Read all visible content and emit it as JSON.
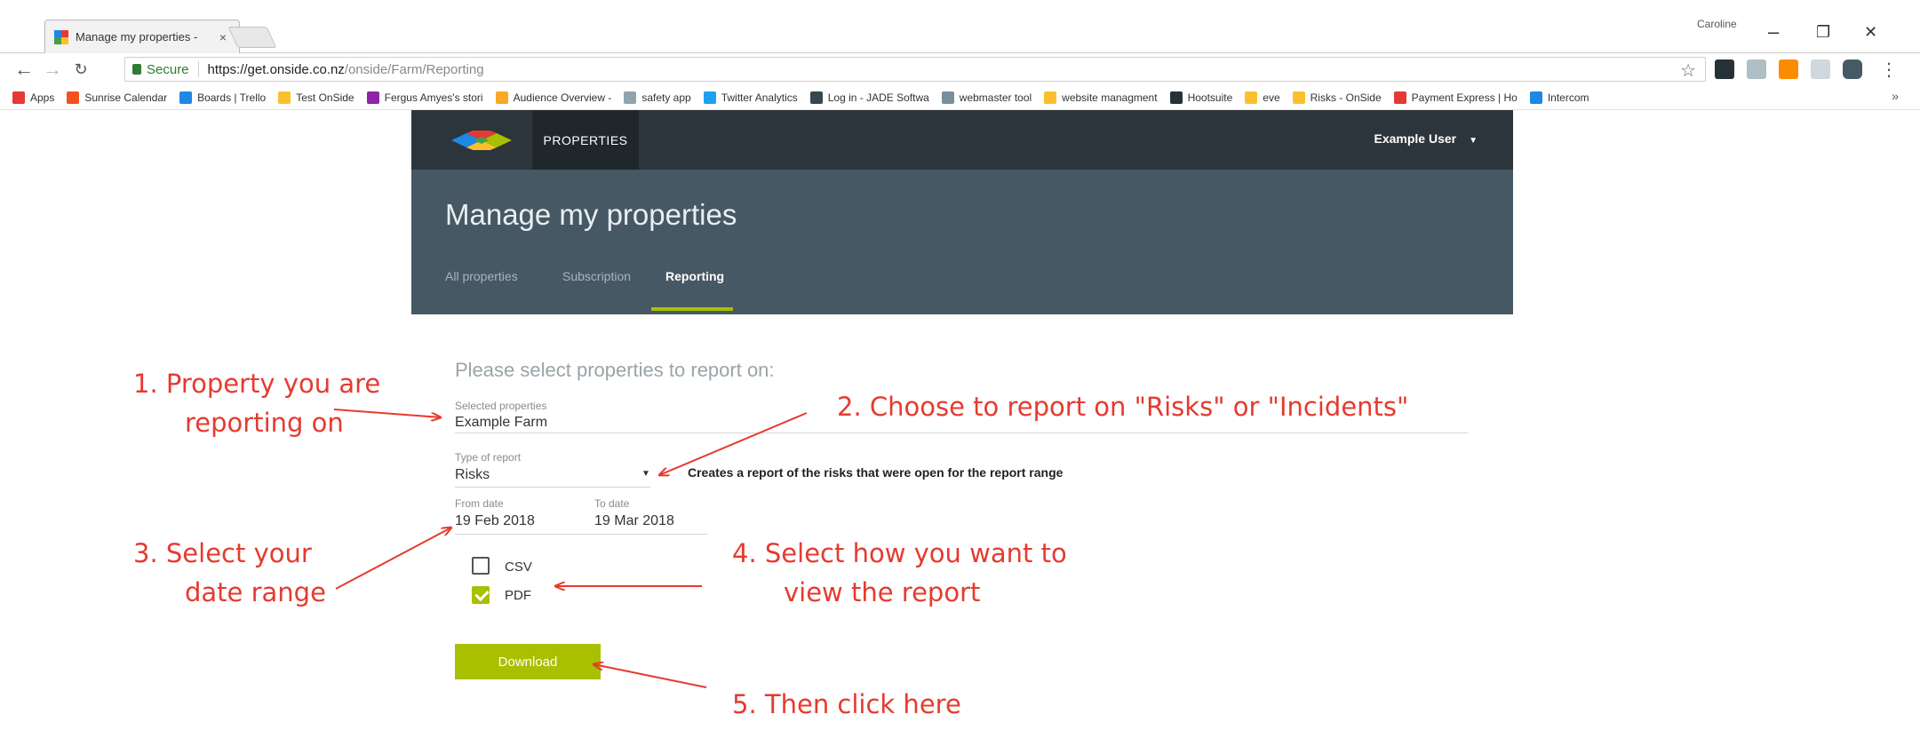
{
  "browser": {
    "tab_title": "Manage my properties -",
    "tab_close": "×",
    "profile_name": "Caroline",
    "window_controls": [
      "–",
      "❐",
      "✕"
    ],
    "secure_label": "Secure",
    "url_host": "https://get.onside.co.nz",
    "url_path": "/onside/Farm/Reporting",
    "bookmarks": [
      {
        "label": "Apps",
        "color": "#e53935"
      },
      {
        "label": "Sunrise Calendar",
        "color": "#f4511e"
      },
      {
        "label": "Boards | Trello",
        "color": "#1e88e5"
      },
      {
        "label": "Test OnSide",
        "color": "#fbc02d"
      },
      {
        "label": "Fergus Amyes's stori",
        "color": "#8e24aa"
      },
      {
        "label": "Audience Overview -",
        "color": "#f9a825"
      },
      {
        "label": "safety app",
        "color": "#90a4ae"
      },
      {
        "label": "Twitter Analytics",
        "color": "#1da1f2"
      },
      {
        "label": "Log in - JADE Softwa",
        "color": "#37474f"
      },
      {
        "label": "webmaster tool",
        "color": "#78909c"
      },
      {
        "label": "website managment",
        "color": "#fbc02d"
      },
      {
        "label": "Hootsuite",
        "color": "#263238"
      },
      {
        "label": "eve",
        "color": "#fbc02d"
      },
      {
        "label": "Risks - OnSide",
        "color": "#fbc02d"
      },
      {
        "label": "Payment Express | Ho",
        "color": "#e53935"
      },
      {
        "label": "Intercom",
        "color": "#1e88e5"
      }
    ],
    "bookmarks_more": "»"
  },
  "app": {
    "nav_tab": "PROPERTIES",
    "user": "Example User",
    "page_title": "Manage my properties",
    "subtabs": [
      "All properties",
      "Subscription",
      "Reporting"
    ],
    "accent_color": "#a8c000",
    "nav_color": "#2c353b",
    "header_color": "#465863"
  },
  "form": {
    "prompt": "Please select properties to report on:",
    "selected_label": "Selected properties",
    "selected_value": "Example Farm",
    "type_label": "Type of report",
    "type_value": "Risks",
    "type_help": "Creates a report of the risks that were open for the report range",
    "from_label": "From date",
    "from_value": "19 Feb 2018",
    "to_label": "To date",
    "to_value": "19 Mar 2018",
    "csv_label": "CSV",
    "csv_checked": false,
    "pdf_label": "PDF",
    "pdf_checked": true,
    "download_label": "Download"
  },
  "annotations": {
    "step1_line1": "1.  Property you are",
    "step1_line2": "reporting on",
    "step2": "2.  Choose to report on \"Risks\" or \"Incidents\"",
    "step3_line1": "3.  Select your",
    "step3_line2": "date range",
    "step4_line1": "4.  Select how you want to",
    "step4_line2": "view the report",
    "step5": "5.  Then click here",
    "color": "#e63a2f"
  }
}
